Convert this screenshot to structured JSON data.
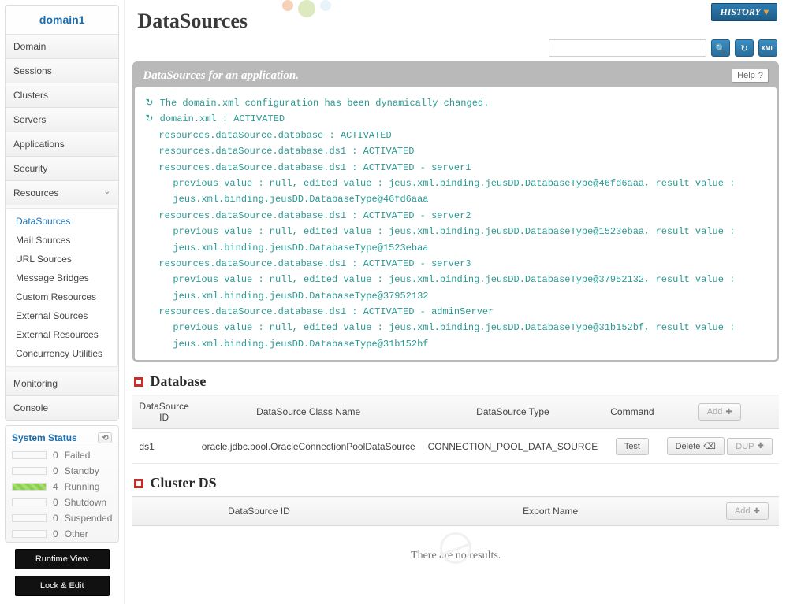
{
  "sidebar": {
    "domain_title": "domain1",
    "items": [
      {
        "label": "Domain"
      },
      {
        "label": "Sessions"
      },
      {
        "label": "Clusters"
      },
      {
        "label": "Servers"
      },
      {
        "label": "Applications"
      },
      {
        "label": "Security"
      },
      {
        "label": "Resources"
      }
    ],
    "resources_sub": [
      {
        "label": "DataSources",
        "active": true
      },
      {
        "label": "Mail Sources"
      },
      {
        "label": "URL Sources"
      },
      {
        "label": "Message Bridges"
      },
      {
        "label": "Custom Resources"
      },
      {
        "label": "External Sources"
      },
      {
        "label": "External Resources"
      },
      {
        "label": "Concurrency Utilities"
      }
    ],
    "bottom_items": [
      {
        "label": "Monitoring"
      },
      {
        "label": "Console"
      }
    ],
    "system_status": {
      "title": "System Status",
      "rows": [
        {
          "count": "0",
          "label": "Failed",
          "full": false
        },
        {
          "count": "0",
          "label": "Standby",
          "full": false
        },
        {
          "count": "4",
          "label": "Running",
          "full": true
        },
        {
          "count": "0",
          "label": "Shutdown",
          "full": false
        },
        {
          "count": "0",
          "label": "Suspended",
          "full": false
        },
        {
          "count": "0",
          "label": "Other",
          "full": false
        }
      ]
    },
    "runtime_btn": "Runtime View",
    "lock_btn": "Lock & Edit"
  },
  "history_label": "HISTORY",
  "page_title": "DataSources",
  "search_placeholder": "",
  "panel": {
    "title": "DataSources for an application.",
    "help": "Help",
    "log": [
      {
        "indent": 0,
        "icon": true,
        "text": "The domain.xml configuration has been dynamically changed."
      },
      {
        "indent": 0,
        "icon": true,
        "text": "domain.xml : ACTIVATED"
      },
      {
        "indent": 1,
        "text": "resources.dataSource.database : ACTIVATED"
      },
      {
        "indent": 1,
        "text": "resources.dataSource.database.ds1 : ACTIVATED"
      },
      {
        "indent": 1,
        "text": "resources.dataSource.database.ds1 : ACTIVATED - server1"
      },
      {
        "indent": 2,
        "text": "previous value : null, edited value : jeus.xml.binding.jeusDD.DatabaseType@46fd6aaa, result value : jeus.xml.binding.jeusDD.DatabaseType@46fd6aaa"
      },
      {
        "indent": 1,
        "text": "resources.dataSource.database.ds1 : ACTIVATED - server2"
      },
      {
        "indent": 2,
        "text": "previous value : null, edited value : jeus.xml.binding.jeusDD.DatabaseType@1523ebaa, result value : jeus.xml.binding.jeusDD.DatabaseType@1523ebaa"
      },
      {
        "indent": 1,
        "text": "resources.dataSource.database.ds1 : ACTIVATED - server3"
      },
      {
        "indent": 2,
        "text": "previous value : null, edited value : jeus.xml.binding.jeusDD.DatabaseType@37952132, result value : jeus.xml.binding.jeusDD.DatabaseType@37952132"
      },
      {
        "indent": 1,
        "text": "resources.dataSource.database.ds1 : ACTIVATED - adminServer"
      },
      {
        "indent": 2,
        "text": "previous value : null, edited value : jeus.xml.binding.jeusDD.DatabaseType@31b152bf, result value : jeus.xml.binding.jeusDD.DatabaseType@31b152bf"
      }
    ]
  },
  "db": {
    "title": "Database",
    "cols": [
      "DataSource ID",
      "DataSource Class Name",
      "DataSource Type",
      "Command",
      ""
    ],
    "add": "Add",
    "rows": [
      {
        "id": "ds1",
        "cls": "oracle.jdbc.pool.OracleConnectionPoolDataSource",
        "type": "CONNECTION_POOL_DATA_SOURCE",
        "test": "Test",
        "del": "Delete",
        "dup": "DUP"
      }
    ]
  },
  "cluster": {
    "title": "Cluster DS",
    "cols": [
      "DataSource ID",
      "Export Name",
      ""
    ],
    "add": "Add",
    "empty": "There are no results."
  }
}
